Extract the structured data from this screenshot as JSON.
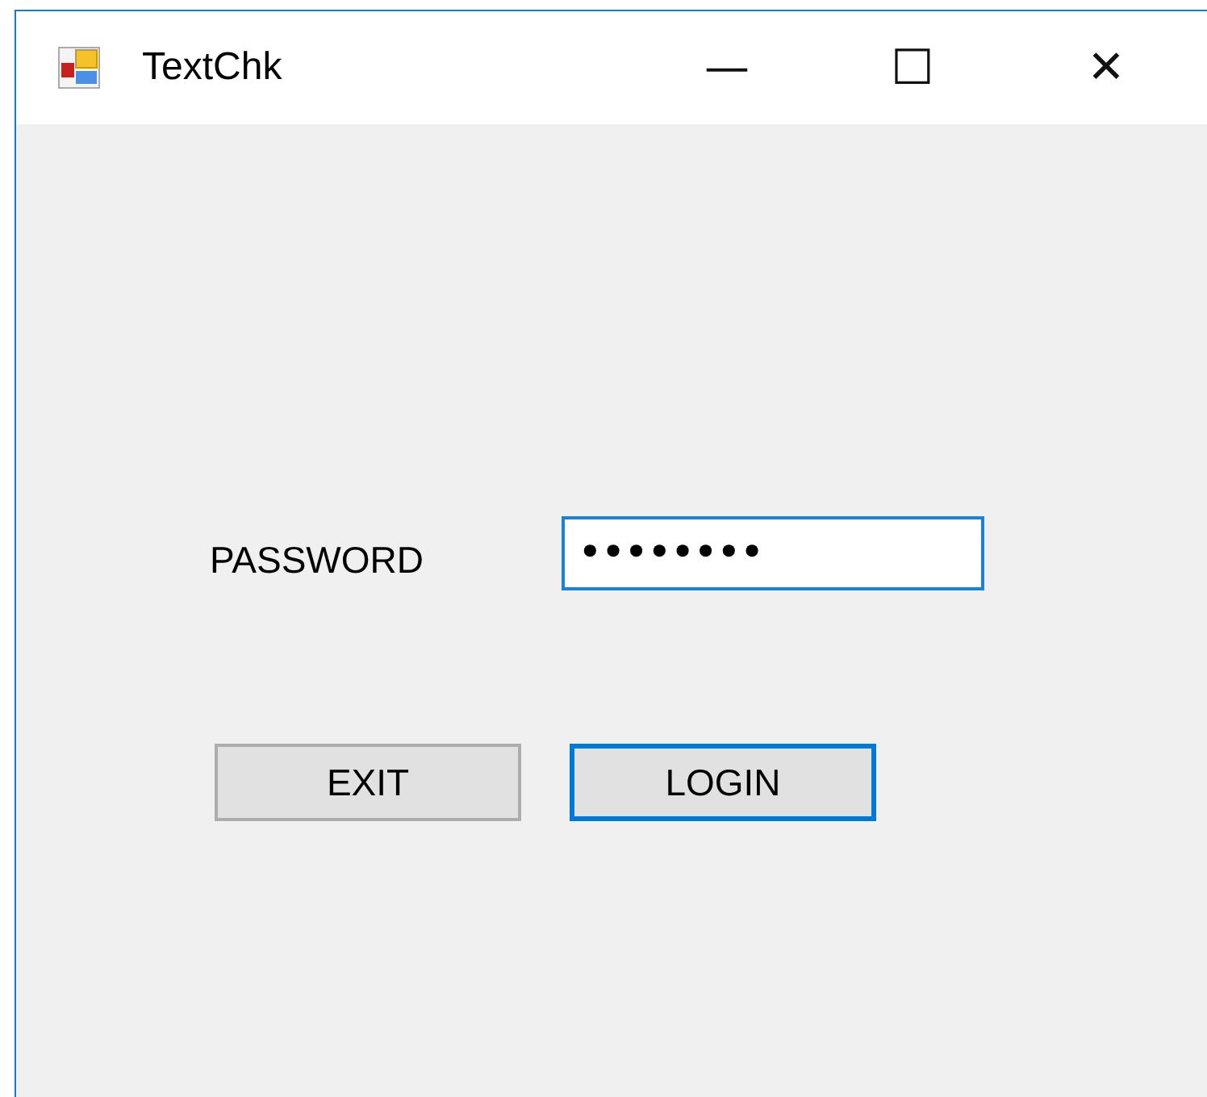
{
  "window": {
    "title": "TextChk",
    "controls": [
      "—",
      "☐",
      "✕"
    ]
  },
  "password": {
    "label": "PASSWORD",
    "value": "••••••••",
    "focused": true
  },
  "buttons": [
    {
      "label": "EXIT",
      "focused": false
    },
    {
      "label": "LOGIN",
      "focused": true
    }
  ]
}
